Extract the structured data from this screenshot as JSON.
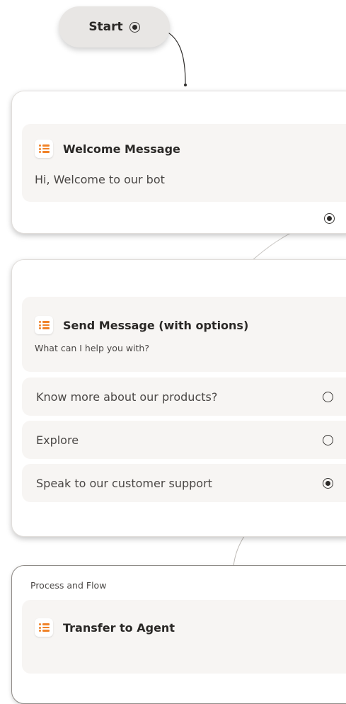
{
  "start": {
    "label": "Start",
    "icon": "radio-selected-icon"
  },
  "welcome_node": {
    "title": "Welcome Message",
    "message": "Hi, Welcome to our bot",
    "icon": "list-icon",
    "output_connector": "radio-selected-icon"
  },
  "options_node": {
    "title": "Send Message (with options)",
    "subtitle": "What can I help you with?",
    "icon": "list-icon",
    "options": [
      {
        "label": "Know more about our products?",
        "selected": false
      },
      {
        "label": "Explore",
        "selected": false
      },
      {
        "label": "Speak to our customer support",
        "selected": true
      }
    ]
  },
  "transfer_node": {
    "caption": "Process and Flow",
    "title": "Transfer to Agent",
    "icon": "list-icon"
  },
  "colors": {
    "accent": "#f08228",
    "card_border": "#e1dedb",
    "block_bg": "#f7f5f3",
    "start_bg": "#e8e6e4"
  }
}
